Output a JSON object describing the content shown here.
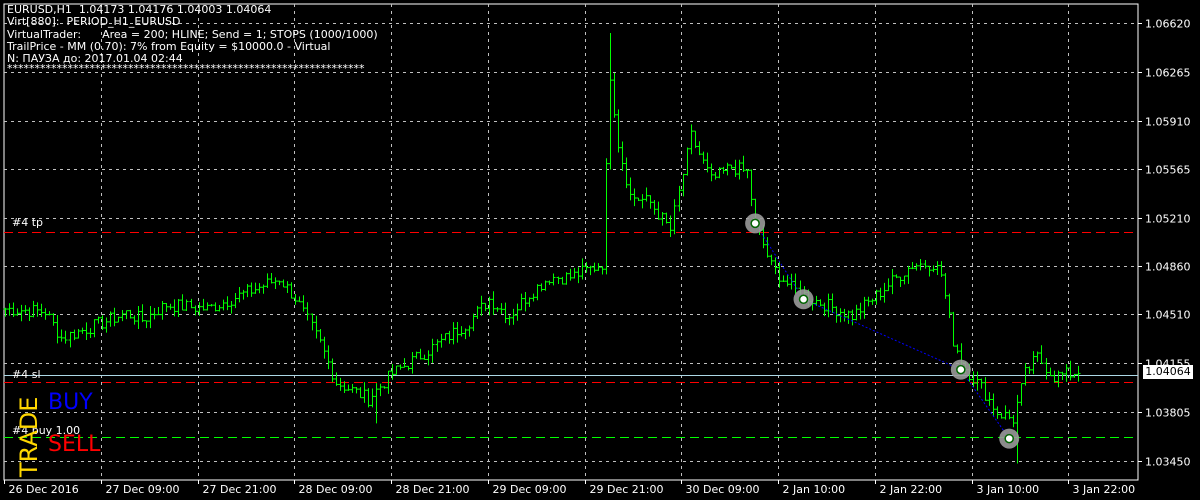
{
  "info_lines": [
    "EURUSD,H1  1.04173 1.04176 1.04003 1.04064",
    "Virt[880]:  PERIOD_H1_EURUSD",
    "VirtualTrader:      Area = 200; HLINE; Send = 1; STOPS (1000/1000)",
    "TrailPrice - MM (0.70): 7% from Equity = $10000.0 - Virtual",
    "N: ПАУЗА до: 2017.01.04 02:44",
    "*****************************************************************"
  ],
  "colors": {
    "background": "#000000",
    "grid": "#c0c0c0",
    "candles": "#00ff00",
    "axis_text": "#ffffff",
    "tp_line": "#ff0000",
    "sl_line": "#ff0000",
    "buy_line": "#00ff00",
    "current_line": "#add8e6",
    "trade_path": "#0000ff",
    "trade_word": "#ffd700",
    "buy_word": "#0000ff",
    "sell_word": "#ff0000"
  },
  "levels": {
    "tp_label": "#4 tp",
    "sl_label": "#4 sl",
    "buy_label": "#4 buy 1.00",
    "tp_price": 1.0511,
    "sl_price": 1.0402,
    "buy_price": 1.0362,
    "current_price": 1.04073
  },
  "current_price_label": "1.04064",
  "trade_panel": {
    "trade": "TRADE",
    "buy": "BUY",
    "sell": "SELL"
  },
  "chart_data": {
    "type": "candlestick",
    "symbol": "EURUSD",
    "timeframe": "H1",
    "ylim": [
      1.0331,
      1.0676
    ],
    "y_ticks": [
      "1.06620",
      "1.06265",
      "1.05910",
      "1.05565",
      "1.05210",
      "1.04860",
      "1.04510",
      "1.04155",
      "1.03805",
      "1.03450"
    ],
    "x_ticks": [
      "26 Dec 2016",
      "27 Dec 09:00",
      "27 Dec 21:00",
      "28 Dec 09:00",
      "28 Dec 21:00",
      "29 Dec 09:00",
      "29 Dec 21:00",
      "30 Dec 09:00",
      "2 Jan 10:00",
      "2 Jan 22:00",
      "3 Jan 10:00",
      "3 Jan 22:00"
    ],
    "grid": true,
    "trade_markers": [
      {
        "x_index": 186,
        "price": 1.0517
      },
      {
        "x_index": 198,
        "price": 1.0462
      },
      {
        "x_index": 237,
        "price": 1.0411
      },
      {
        "x_index": 249,
        "price": 1.0361
      }
    ],
    "anchors": [
      [
        0,
        1.0455
      ],
      [
        10,
        1.0453
      ],
      [
        14,
        1.0434
      ],
      [
        24,
        1.0445
      ],
      [
        30,
        1.0452
      ],
      [
        34,
        1.0447
      ],
      [
        40,
        1.0458
      ],
      [
        50,
        1.0455
      ],
      [
        60,
        1.0467
      ],
      [
        68,
        1.0477
      ],
      [
        72,
        1.0463
      ],
      [
        78,
        1.043
      ],
      [
        82,
        1.0402
      ],
      [
        90,
        1.039
      ],
      [
        96,
        1.0408
      ],
      [
        105,
        1.0425
      ],
      [
        115,
        1.0446
      ],
      [
        120,
        1.0462
      ],
      [
        125,
        1.045
      ],
      [
        130,
        1.0466
      ],
      [
        135,
        1.0478
      ],
      [
        140,
        1.0478
      ],
      [
        145,
        1.0484
      ],
      [
        148,
        1.0488
      ],
      [
        150,
        1.0625
      ],
      [
        152,
        1.0575
      ],
      [
        155,
        1.0537
      ],
      [
        160,
        1.0532
      ],
      [
        165,
        1.0512
      ],
      [
        170,
        1.058
      ],
      [
        175,
        1.0548
      ],
      [
        180,
        1.0558
      ],
      [
        184,
        1.0554
      ],
      [
        186,
        1.0517
      ],
      [
        190,
        1.0486
      ],
      [
        195,
        1.047
      ],
      [
        200,
        1.0462
      ],
      [
        210,
        1.045
      ],
      [
        215,
        1.0462
      ],
      [
        220,
        1.0475
      ],
      [
        225,
        1.0487
      ],
      [
        230,
        1.0488
      ],
      [
        232,
        1.048
      ],
      [
        235,
        1.0432
      ],
      [
        238,
        1.0412
      ],
      [
        242,
        1.0398
      ],
      [
        246,
        1.038
      ],
      [
        250,
        1.0375
      ],
      [
        253,
        1.0408
      ],
      [
        256,
        1.042
      ],
      [
        260,
        1.0406
      ],
      [
        264,
        1.0408
      ],
      [
        266,
        1.041
      ]
    ]
  }
}
